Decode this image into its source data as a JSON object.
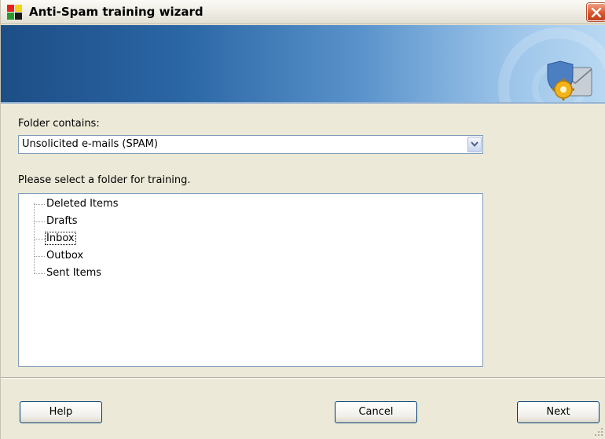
{
  "window": {
    "title": "Anti-Spam training wizard"
  },
  "form": {
    "folder_contains_label": "Folder contains:",
    "folder_contains_value": "Unsolicited e-mails (SPAM)",
    "select_folder_label": "Please select a folder for training."
  },
  "tree": {
    "items": [
      {
        "label": "Deleted Items",
        "selected": false
      },
      {
        "label": "Drafts",
        "selected": false
      },
      {
        "label": "Inbox",
        "selected": true
      },
      {
        "label": "Outbox",
        "selected": false
      },
      {
        "label": "Sent Items",
        "selected": false
      }
    ]
  },
  "buttons": {
    "help": "Help",
    "cancel": "Cancel",
    "next": "Next"
  },
  "icons": {
    "app": "avg-logo-icon",
    "close": "close-icon",
    "banner": "mail-gear-shield-icon",
    "dropdown": "chevron-down-icon",
    "resize": "resize-grip-icon"
  },
  "colors": {
    "banner_start": "#1d4e86",
    "banner_end": "#b8d8f2",
    "close_button": "#d6582f",
    "window_bg": "#ece9d8"
  }
}
